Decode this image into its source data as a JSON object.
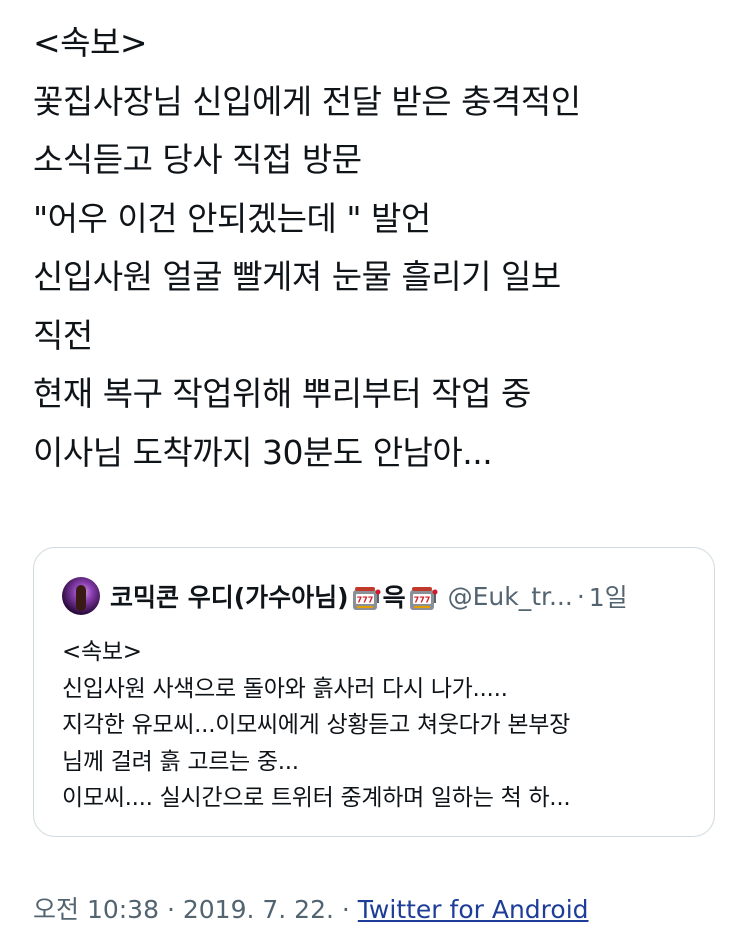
{
  "tweet": {
    "lines": [
      "<속보>",
      "꽃집사장님 신입에게 전달 받은 충격적인",
      "소식듣고 당사 직접 방문",
      "\"어우 이건 안되겠는데 \" 발언",
      "신입사원 얼굴 빨게져 눈물 흘리기 일보",
      "직전",
      "현재 복구 작업위해 뿌리부터 작업 중",
      "이사님 도착까지 30분도 안남아..."
    ]
  },
  "quote": {
    "name_prefix": "코믹콘 우디(가수아님)",
    "name_middle": "윽",
    "handle": "@Euk_tr...",
    "separator": "·",
    "time": "1일",
    "icons": {
      "avatar": "profile-avatar",
      "emoji": "slot-machine-icon"
    },
    "lines": [
      "<속보>",
      "신입사원 사색으로 돌아와 흙사러 다시 나가.....",
      "지각한 유모씨...이모씨에게 상황듣고 쳐웃다가 본부장",
      "님께 걸려 흙 고르는 중...",
      "이모씨.... 실시간으로 트위터 중계하며 일하는 척 하..."
    ]
  },
  "meta": {
    "time": "오전 10:38",
    "sep1": "·",
    "date": "2019. 7. 22.",
    "sep2": "·",
    "source": "Twitter for Android"
  },
  "colors": {
    "text": "#0f1419",
    "muted": "#536471",
    "border": "#cfd9de",
    "link": "#1d3d99"
  }
}
